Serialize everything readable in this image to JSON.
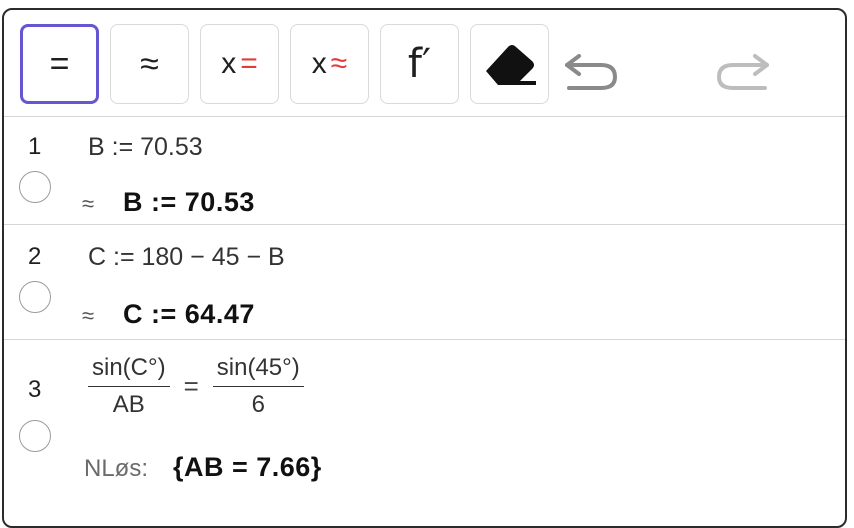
{
  "toolbar": {
    "buttons": [
      {
        "name": "exact-eval-button",
        "label": "="
      },
      {
        "name": "numeric-eval-button",
        "label": "≈"
      },
      {
        "name": "solve-button",
        "prefix": "x",
        "symbol": "="
      },
      {
        "name": "nsolve-button",
        "prefix": "x",
        "symbol": "≈"
      },
      {
        "name": "derivative-button",
        "label": "f′"
      }
    ],
    "icons": [
      "eraser-icon",
      "undo-icon",
      "redo-icon"
    ]
  },
  "rows": [
    {
      "number": "1",
      "input": "B := 70.53",
      "approx": "≈",
      "output": "B := 70.53"
    },
    {
      "number": "2",
      "input": "C := 180 − 45 − B",
      "approx": "≈",
      "output": "C := 64.47"
    },
    {
      "number": "3",
      "lhs_num": "sin(C°)",
      "lhs_den": "AB",
      "eq": "=",
      "rhs_num": "sin(45°)",
      "rhs_den": "6",
      "result_label": "NLøs:",
      "output": "{AB = 7.66}"
    }
  ],
  "colors": {
    "active_border": "#6557d2",
    "red_symbol": "#e23b3b",
    "disabled_icon": "#bdbdbd",
    "undo_icon": "#8a8a8a"
  }
}
